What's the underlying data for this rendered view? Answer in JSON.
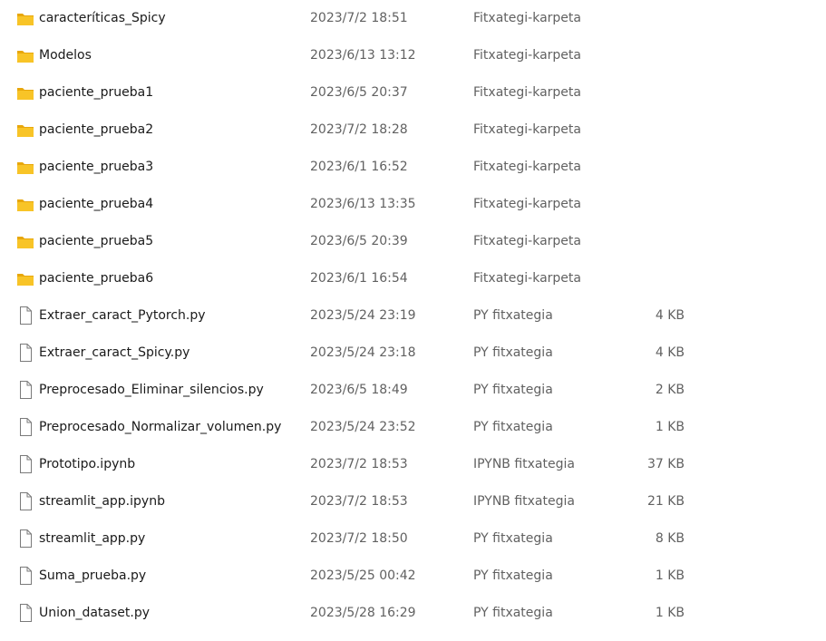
{
  "files": [
    {
      "name": "caracteríticas_Spicy",
      "date": "2023/7/2 18:51",
      "type": "Fitxategi-karpeta",
      "size": "",
      "icon": "folder-icon"
    },
    {
      "name": "Modelos",
      "date": "2023/6/13 13:12",
      "type": "Fitxategi-karpeta",
      "size": "",
      "icon": "folder-icon"
    },
    {
      "name": "paciente_prueba1",
      "date": "2023/6/5 20:37",
      "type": "Fitxategi-karpeta",
      "size": "",
      "icon": "folder-icon"
    },
    {
      "name": "paciente_prueba2",
      "date": "2023/7/2 18:28",
      "type": "Fitxategi-karpeta",
      "size": "",
      "icon": "folder-icon"
    },
    {
      "name": "paciente_prueba3",
      "date": "2023/6/1 16:52",
      "type": "Fitxategi-karpeta",
      "size": "",
      "icon": "folder-icon"
    },
    {
      "name": "paciente_prueba4",
      "date": "2023/6/13 13:35",
      "type": "Fitxategi-karpeta",
      "size": "",
      "icon": "folder-icon"
    },
    {
      "name": "paciente_prueba5",
      "date": "2023/6/5 20:39",
      "type": "Fitxategi-karpeta",
      "size": "",
      "icon": "folder-icon"
    },
    {
      "name": "paciente_prueba6",
      "date": "2023/6/1 16:54",
      "type": "Fitxategi-karpeta",
      "size": "",
      "icon": "folder-icon"
    },
    {
      "name": "Extraer_caract_Pytorch.py",
      "date": "2023/5/24 23:19",
      "type": "PY fitxategia",
      "size": "4 KB",
      "icon": "file-icon"
    },
    {
      "name": "Extraer_caract_Spicy.py",
      "date": "2023/5/24 23:18",
      "type": "PY fitxategia",
      "size": "4 KB",
      "icon": "file-icon"
    },
    {
      "name": "Preprocesado_Eliminar_silencios.py",
      "date": "2023/6/5 18:49",
      "type": "PY fitxategia",
      "size": "2 KB",
      "icon": "file-icon"
    },
    {
      "name": "Preprocesado_Normalizar_volumen.py",
      "date": "2023/5/24 23:52",
      "type": "PY fitxategia",
      "size": "1 KB",
      "icon": "file-icon"
    },
    {
      "name": "Prototipo.ipynb",
      "date": "2023/7/2 18:53",
      "type": "IPYNB fitxategia",
      "size": "37 KB",
      "icon": "file-icon"
    },
    {
      "name": "streamlit_app.ipynb",
      "date": "2023/7/2 18:53",
      "type": "IPYNB fitxategia",
      "size": "21 KB",
      "icon": "file-icon"
    },
    {
      "name": "streamlit_app.py",
      "date": "2023/7/2 18:50",
      "type": "PY fitxategia",
      "size": "8 KB",
      "icon": "file-icon"
    },
    {
      "name": "Suma_prueba.py",
      "date": "2023/5/25 00:42",
      "type": "PY fitxategia",
      "size": "1 KB",
      "icon": "file-icon"
    },
    {
      "name": "Union_dataset.py",
      "date": "2023/5/28 16:29",
      "type": "PY fitxategia",
      "size": "1 KB",
      "icon": "file-icon"
    }
  ],
  "colors": {
    "folder_body": "#f8c427",
    "folder_back": "#e8a70c",
    "file_outline": "#7a7a7a",
    "secondary_text": "#616161"
  }
}
